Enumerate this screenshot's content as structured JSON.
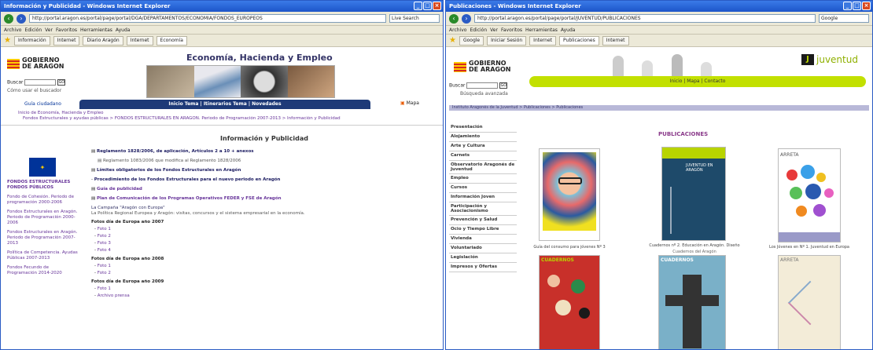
{
  "win1": {
    "title": "Información y Publicidad - Windows Internet Explorer",
    "url": "http://portal.aragon.es/portal/page/portal/DGA/DEPARTAMENTOS/ECONOMIA/FONDOS_EUROPEOS",
    "search_engine": "Live Search",
    "menu": [
      "Archivo",
      "Edición",
      "Ver",
      "Favoritos",
      "Herramientas",
      "Ayuda"
    ],
    "tabs": [
      "Información",
      "Internet",
      "Diario Aragón",
      "Internet",
      "Economía"
    ],
    "logo_line1": "GOBIERNO",
    "logo_line2": "DE ARAGON",
    "header_title": "Economía, Hacienda y Empleo",
    "buscar_label": "Buscar",
    "search_link": "Cómo usar el buscador",
    "nav_left": "Guía ciudadano",
    "nav_center": "Inicio Tema | Itinerarios Tema | Novedades",
    "nav_right": "Mapa",
    "breadcrumb1": "Inicio de Economía, Hacienda y Empleo",
    "breadcrumb2": "Fondos Estructurales y ayudas públicas > FONDOS ESTRUCTURALES EN ARAGÓN. Periodo de Programación 2007-2013 > Información y Publicidad",
    "section_title": "Información y Publicidad",
    "side_banner": "FONDOS ESTRUCTURALES FONDOS PÚBLICOS",
    "side_links": [
      "Fondo de Cohesión. Periodo de programación 2000-2006",
      "Fondos Estructurales en Aragón. Periodo de Programación 2000-2006",
      "Fondos Estructurales en Aragón. Periodo de Programación 2007-2013",
      "Política de Competencia. Ayudas Públicas 2007-2013",
      "Fondos Fecundo de Programación 2014-2020"
    ],
    "items": [
      "Reglamento 1828/2006, de aplicación, Artículos 2 a 10 + anexos",
      "Reglamento 1083/2006 que modifica al Reglamento 1828/2006",
      "Límites obligatorios de los Fondos Estructurales en Aragón",
      "Procedimiento de los Fondos Estructurales para el nuevo periodo en Aragón",
      "Guía de publicidad",
      "Plan de Comunicación de los Programas Operativos FEDER y FSE de Aragón"
    ],
    "campaign_title": "La Campaña \"Aragón con Europa\"",
    "campaign_text": "La Política Regional Europea y Aragón: visitas, concursos y el sistema empresarial en la economía.",
    "photo_groups": [
      {
        "title": "Fotos día de Europa año 2007",
        "photos": [
          "Foto 1",
          "Foto 2",
          "Foto 3",
          "Foto 4"
        ]
      },
      {
        "title": "Fotos día de Europa año 2008",
        "photos": [
          "Foto 1",
          "Foto 2"
        ]
      },
      {
        "title": "Fotos día de Europa año 2009",
        "photos": [
          "Foto 1",
          "Archivo prensa"
        ]
      }
    ]
  },
  "win2": {
    "title": "Publicaciones - Windows Internet Explorer",
    "url": "http://portal.aragon.es/portal/page/portal/JUVENTUD/PUBLICACIONES",
    "search_engine": "Google",
    "menu": [
      "Archivo",
      "Edición",
      "Ver",
      "Favoritos",
      "Herramientas",
      "Ayuda"
    ],
    "tabs": [
      "Google",
      "Iniciar Sesión",
      "Internet",
      "Publicaciones",
      "Internet"
    ],
    "logo_line1": "GOBIERNO",
    "logo_line2": "DE ARAGON",
    "brand": "juventud",
    "green_banner": "Inicio | Mapa | Contacto",
    "buscar_label": "Buscar",
    "search_link": "Búsqueda avanzada",
    "breadcrumb": "Instituto Aragonés de la Juventud > Publicaciones > Publicaciones",
    "menu_items": [
      "Presentación",
      "Alojamiento",
      "Arte y Cultura",
      "Carnets",
      "Observatorio Aragonés de Juventud",
      "Empleo",
      "Cursos",
      "Información Joven",
      "Participación y Asociacionismo",
      "Prevención y Salud",
      "Ocio y Tiempo Libre",
      "Vivienda",
      "Voluntariado",
      "Legislación",
      "Impresos y Ofertas"
    ],
    "page_title": "PUBLICACIONES",
    "captions": [
      "Guía del consumo para jóvenes Nº 3",
      "Cuadernos nº 2. Educación en Aragón. Diseño",
      "Los Jóvenes en Nº 1. Juventud en Europa"
    ],
    "sub_caption": "Cuadernos del Aragón",
    "card_labels": [
      "",
      "JUVENTUD EN ARAGÓN",
      "ARRETA",
      "CUADERNOS",
      "CUADERNOS",
      "ARRETA"
    ]
  }
}
